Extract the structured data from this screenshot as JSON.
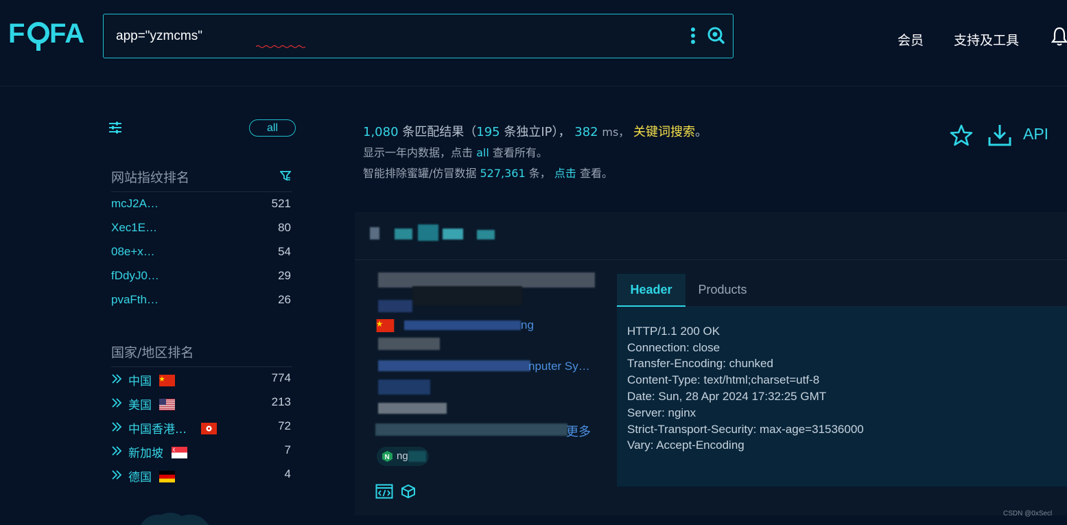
{
  "brand": {
    "logo_text": "FOFA"
  },
  "search": {
    "query": "app=\"yzmcms\""
  },
  "nav": {
    "member": "会员",
    "tools": "支持及工具"
  },
  "sidebar": {
    "all_label": "all",
    "fingerprint_title": "网站指纹排名",
    "fingerprints": [
      {
        "label": "mcJ2A…",
        "count": "521"
      },
      {
        "label": "Xec1E…",
        "count": "80"
      },
      {
        "label": "08e+x…",
        "count": "54"
      },
      {
        "label": "fDdyJ0…",
        "count": "29"
      },
      {
        "label": "pvaFth…",
        "count": "26"
      }
    ],
    "country_title": "国家/地区排名",
    "countries": [
      {
        "label": "中国",
        "count": "774",
        "flag": "cn"
      },
      {
        "label": "美国",
        "count": "213",
        "flag": "us"
      },
      {
        "label": "中国香港…",
        "count": "72",
        "flag": "hk"
      },
      {
        "label": "新加坡",
        "count": "7",
        "flag": "sg"
      },
      {
        "label": "德国",
        "count": "4",
        "flag": "de"
      }
    ]
  },
  "summary": {
    "total": "1,080",
    "total_suffix": "条匹配结果（",
    "ips": "195",
    "ips_suffix": "条独立IP），",
    "ms": "382",
    "ms_unit": "ms，",
    "keyword_search": "关键词搜索",
    "period": "。",
    "line2_prefix": "显示一年内数据，点击",
    "line2_all": "all",
    "line2_suffix": "查看所有。",
    "line3_prefix": "智能排除蜜罐/仿冒数据",
    "line3_count": "527,361",
    "line3_mid": "条，",
    "line3_click": "点击",
    "line3_suffix": "查看。"
  },
  "actions": {
    "api": "API"
  },
  "result": {
    "link_frag_1": "ng",
    "link_frag_2": "nputer Sy…",
    "more_frag": "更多",
    "nginx_frag": "ng",
    "tabs": [
      "Header",
      "Products"
    ],
    "header_lines": [
      "HTTP/1.1 200 OK",
      "Connection: close",
      "Transfer-Encoding: chunked",
      "Content-Type: text/html;charset=utf-8",
      "Date: Sun, 28 Apr 2024 17:32:25 GMT",
      "Server: nginx",
      "Strict-Transport-Security: max-age=31536000",
      "Vary: Accept-Encoding"
    ]
  },
  "watermark": "CSDN @0xSecl",
  "colors": {
    "accent": "#36d6e6",
    "keyword": "#f5e04a",
    "background": "#061226"
  }
}
